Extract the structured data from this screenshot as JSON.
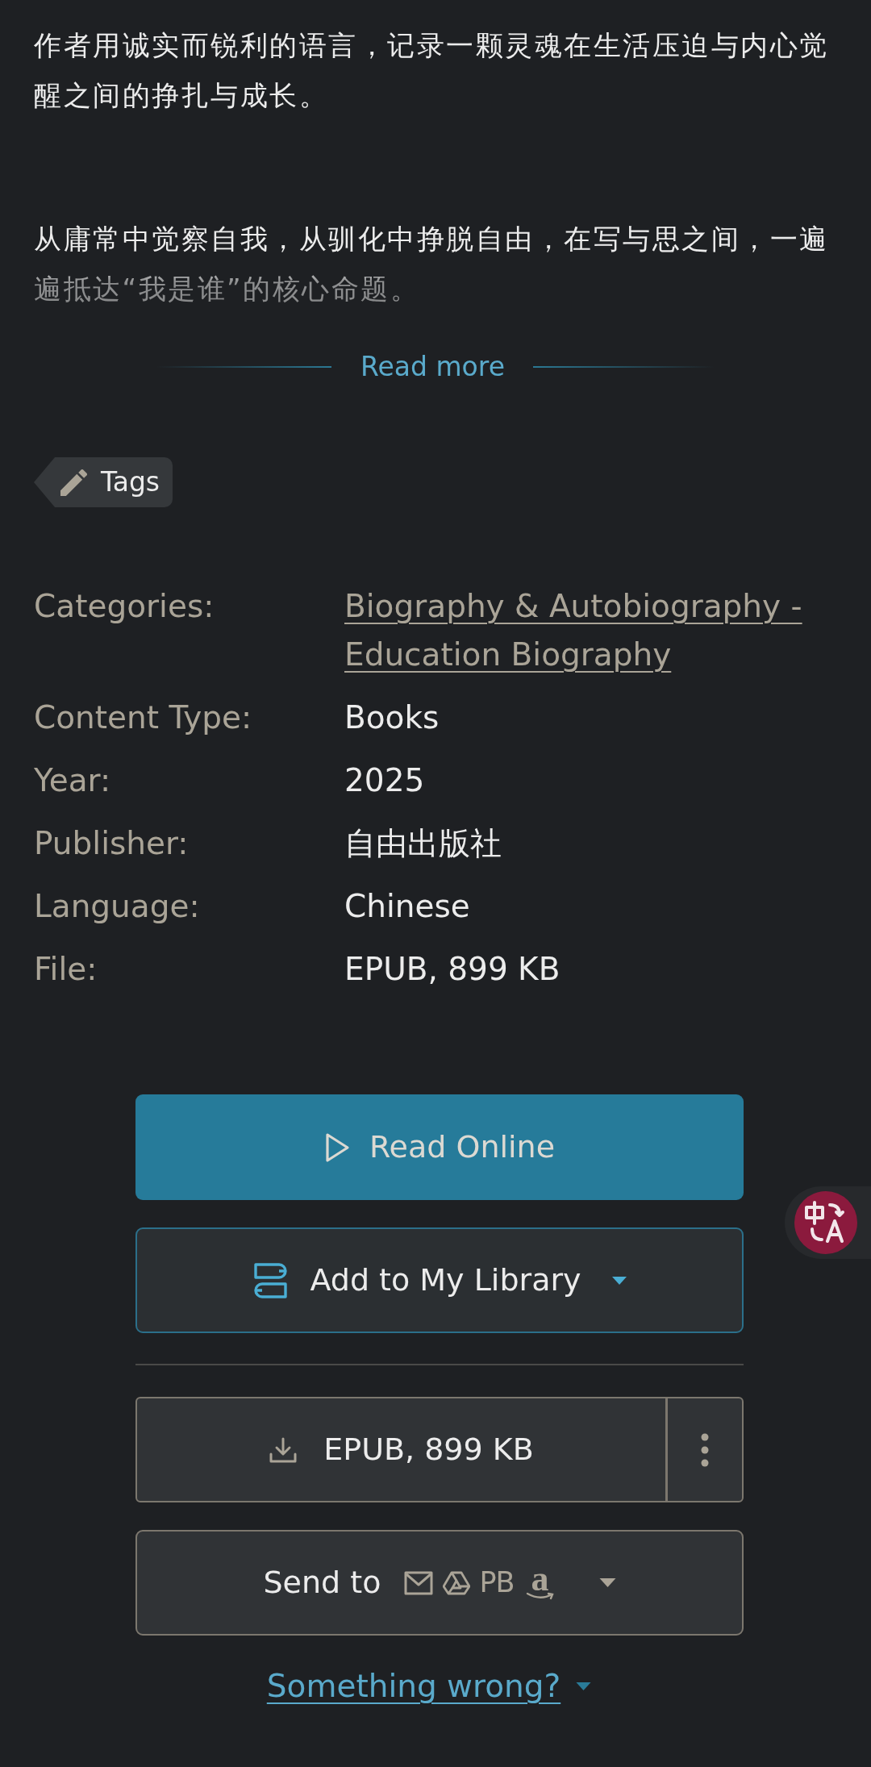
{
  "description": {
    "collapsed": true,
    "paragraphs": [
      "作者用诚实而锐利的语言，记录一颗灵魂在生活压迫与内心觉醒之间的挣扎与成长。",
      "从庸常中觉察自我，从驯化中挣脱自由，在写与思之间，一遍遍抵达“我是谁”的核心命题。"
    ]
  },
  "read_more": {
    "label": "Read more"
  },
  "tags_button": {
    "label": "Tags"
  },
  "details": [
    {
      "kind": "link",
      "label": "Categories:",
      "value": "Biography & Autobiography - Education Biography"
    },
    {
      "kind": "text",
      "label": "Content Type:",
      "value": "Books"
    },
    {
      "kind": "text",
      "label": "Year:",
      "value": "2025"
    },
    {
      "kind": "text",
      "label": "Publisher:",
      "value": "自由出版社"
    },
    {
      "kind": "text",
      "label": "Language:",
      "value": "Chinese"
    },
    {
      "kind": "text",
      "label": "File:",
      "value": "EPUB, 899 KB"
    }
  ],
  "read_online_button": {
    "label": "Read Online"
  },
  "library_button": {
    "label": "Add to My Library"
  },
  "download_button": {
    "label": "EPUB, 899 KB"
  },
  "send_to_button": {
    "label": "Send to",
    "targets": [
      {
        "kind": "mail"
      },
      {
        "kind": "drive"
      },
      {
        "kind": "text",
        "label": "PB"
      },
      {
        "kind": "smile_logo",
        "label": "a"
      }
    ]
  },
  "report_link": {
    "label": "Something wrong?"
  }
}
